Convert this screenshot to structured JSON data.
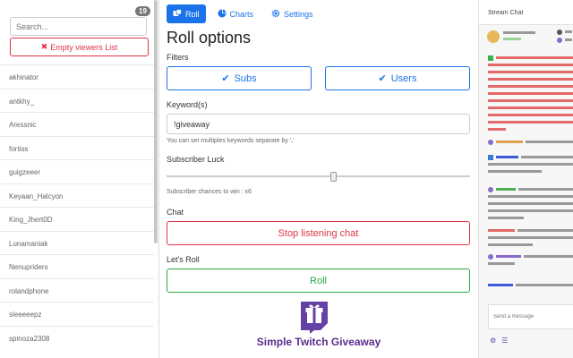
{
  "viewers": {
    "count": "19",
    "search_placeholder": "Search...",
    "empty_button": "Empty viewers List",
    "list": [
      "akhinator",
      "antkhy_",
      "Aressnic",
      "fortiss",
      "guigzeeer",
      "Keyaan_Halcyon",
      "King_Jhert0D",
      "Lunamaniak",
      "Nenupriders",
      "rolandphone",
      "sleeeeepz",
      "spinoza2308"
    ]
  },
  "tabs": [
    {
      "label": "Roll",
      "icon": "dice-icon"
    },
    {
      "label": "Charts",
      "icon": "pie-chart-icon"
    },
    {
      "label": "Settings",
      "icon": "gear-icon"
    }
  ],
  "main": {
    "title": "Roll options",
    "filters_label": "Filters",
    "subs_label": "Subs",
    "users_label": "Users",
    "keywords_label": "Keyword(s)",
    "keyword_value": "!giveaway",
    "keyword_hint": "You can set multiples keywords separate by ','",
    "luck_label": "Subscriber Luck",
    "luck_value": 0.55,
    "luck_hint": "Subscriber chances to win : x6",
    "chat_label": "Chat",
    "stop_button": "Stop listening chat",
    "roll_section_label": "Let's Roll",
    "roll_button": "Roll",
    "brand": "Simple Twitch Giveaway"
  },
  "chat": {
    "header": "Stream Chat",
    "input_placeholder": "Send a message"
  },
  "colors": {
    "primary": "#1a73e8",
    "danger": "#dc3545",
    "success": "#28a745",
    "brand": "#6441a5"
  }
}
